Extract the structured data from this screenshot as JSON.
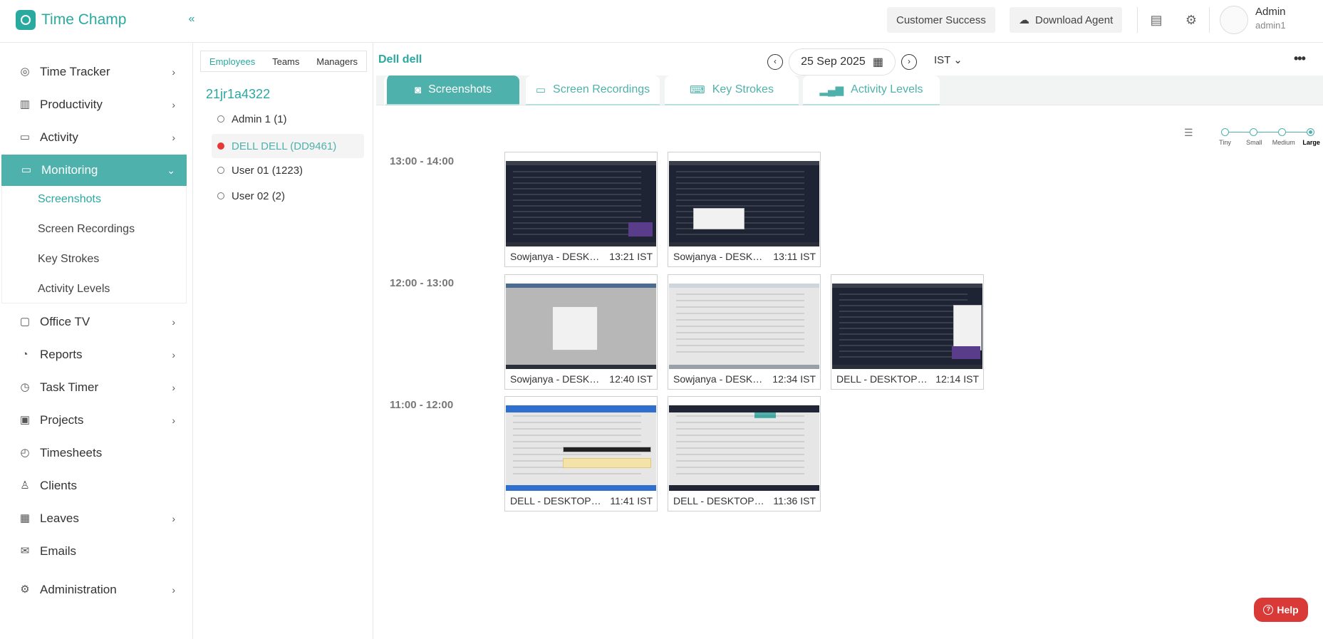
{
  "app": {
    "name": "Time Champ"
  },
  "header": {
    "customer_success": "Customer Success",
    "download_agent": "Download Agent",
    "user_name": "Admin",
    "user_sub": "admin1"
  },
  "sidebar": {
    "items": [
      {
        "label": "Time Tracker",
        "icon": "clock-icon"
      },
      {
        "label": "Productivity",
        "icon": "bar-chart-icon"
      },
      {
        "label": "Activity",
        "icon": "ticket-icon"
      },
      {
        "label": "Monitoring",
        "icon": "monitor-icon"
      },
      {
        "label": "Office TV",
        "icon": "tv-icon"
      },
      {
        "label": "Reports",
        "icon": "pie-chart-icon"
      },
      {
        "label": "Task Timer",
        "icon": "alarm-icon"
      },
      {
        "label": "Projects",
        "icon": "briefcase-icon"
      },
      {
        "label": "Timesheets",
        "icon": "alarm-clock-icon"
      },
      {
        "label": "Clients",
        "icon": "user-icon"
      },
      {
        "label": "Leaves",
        "icon": "calendar-icon"
      },
      {
        "label": "Emails",
        "icon": "mail-icon"
      },
      {
        "label": "Administration",
        "icon": "gear-icon"
      }
    ],
    "monitoring_sub": [
      "Screenshots",
      "Screen Recordings",
      "Key Strokes",
      "Activity Levels"
    ]
  },
  "panel": {
    "tabs": [
      "Employees",
      "Teams",
      "Managers"
    ],
    "team": "21jr1a4322",
    "employees": [
      "Admin 1 (1)",
      "DELL DELL (DD9461)",
      "User 01 (1223)",
      "User 02 (2)"
    ]
  },
  "main": {
    "employee": "Dell dell",
    "date": "25 Sep 2025",
    "timezone": "IST",
    "tabs": [
      "Screenshots",
      "Screen Recordings",
      "Key Strokes",
      "Activity Levels"
    ],
    "sizes": [
      "Tiny",
      "Small",
      "Medium",
      "Large"
    ],
    "selected_size": 3,
    "slots": [
      {
        "label": "13:00 - 14:00",
        "shots": [
          {
            "name": "Sowjanya - DESKTOP-...",
            "time": "13:21 IST"
          },
          {
            "name": "Sowjanya - DESKTOP-...",
            "time": "13:11 IST"
          }
        ]
      },
      {
        "label": "12:00 - 13:00",
        "shots": [
          {
            "name": "Sowjanya - DESKTOP-...",
            "time": "12:40 IST"
          },
          {
            "name": "Sowjanya - DESKTOP-...",
            "time": "12:34 IST"
          },
          {
            "name": "DELL - DESKTOP-AP...",
            "time": "12:14 IST"
          }
        ]
      },
      {
        "label": "11:00 - 12:00",
        "shots": [
          {
            "name": "DELL - DESKTOP-AP...",
            "time": "11:41 IST"
          },
          {
            "name": "DELL - DESKTOP-AP...",
            "time": "11:36 IST"
          }
        ]
      }
    ]
  },
  "help": {
    "label": "Help"
  },
  "colors": {
    "accent": "#4eb1ab",
    "brand": "#2aa9a0",
    "help": "#d93a37",
    "online": "#e53935"
  }
}
